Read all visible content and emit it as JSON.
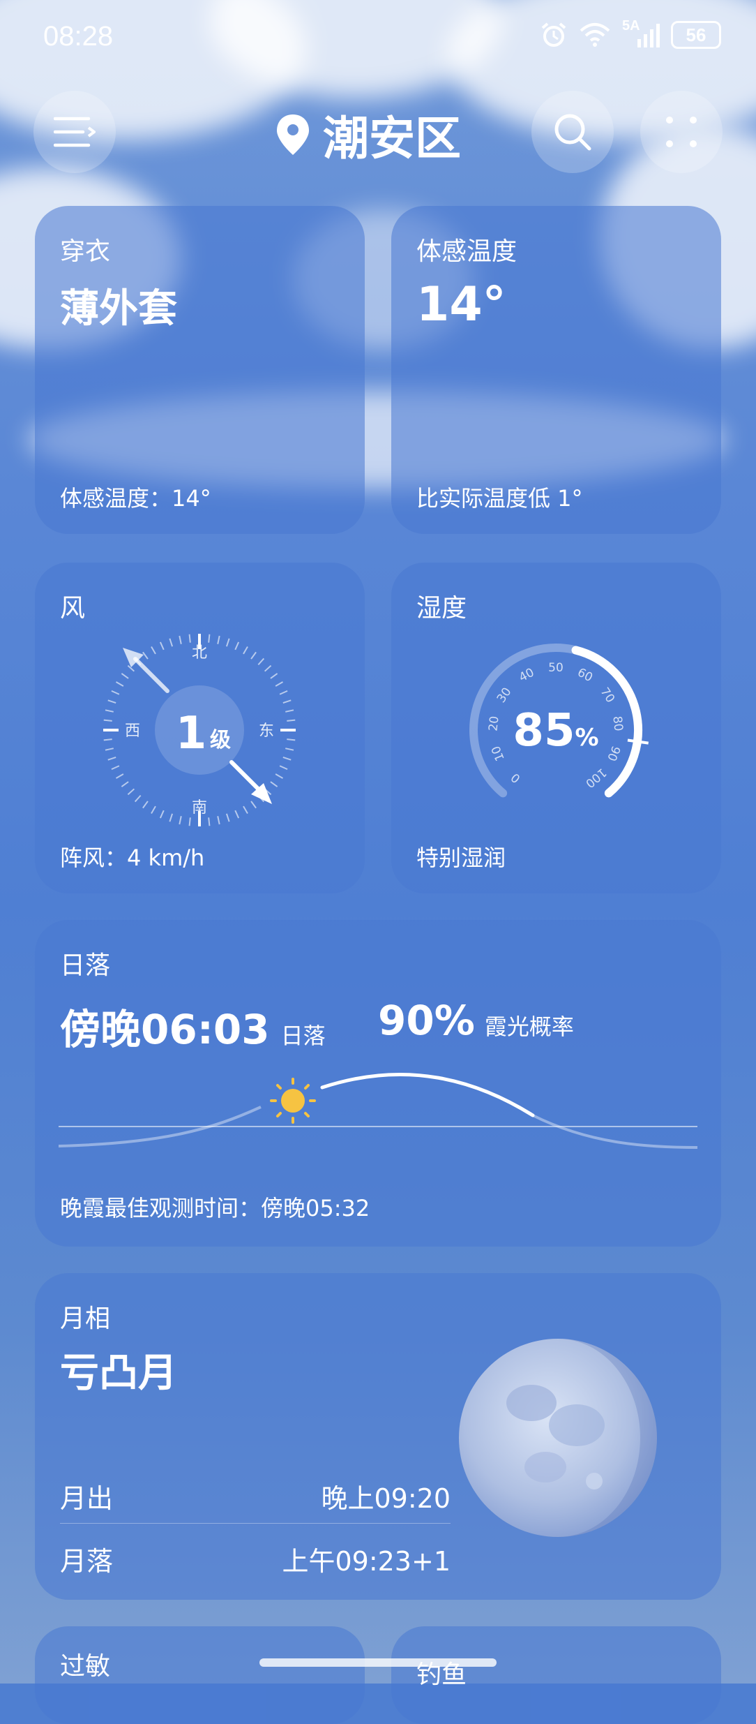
{
  "status": {
    "time": "08:28",
    "network": "5A",
    "battery": "56"
  },
  "header": {
    "location": "潮安区"
  },
  "clothing": {
    "title": "穿衣",
    "value": "薄外套",
    "footer": "体感温度：14°"
  },
  "feels_like": {
    "title": "体感温度",
    "value": "14°",
    "footer": "比实际温度低 1°"
  },
  "wind": {
    "title": "风",
    "level_num": "1",
    "level_unit": "级",
    "compass": {
      "n": "北",
      "s": "南",
      "e": "东",
      "w": "西"
    },
    "footer": "阵风：4 km/h"
  },
  "humidity": {
    "title": "湿度",
    "value": "85",
    "unit": "%",
    "footer": "特别湿润",
    "fraction": 0.85,
    "ticks": [
      "0",
      "10",
      "20",
      "30",
      "40",
      "50",
      "60",
      "70",
      "80",
      "90",
      "100"
    ]
  },
  "sunset": {
    "title": "日落",
    "time": "傍晚06:03",
    "time_label": "日落",
    "glow_prob": "90%",
    "glow_label": "霞光概率",
    "best_time": "晚霞最佳观测时间：傍晚05:32"
  },
  "moon": {
    "title": "月相",
    "phase": "亏凸月",
    "rise_label": "月出",
    "rise_time": "晚上09:20",
    "set_label": "月落",
    "set_time": "上午09:23+1"
  },
  "bottom_cards": {
    "allergy": "过敏",
    "fishing": "钓鱼"
  },
  "colors": {
    "sun": "#f6c342",
    "card": "#4878d2"
  }
}
